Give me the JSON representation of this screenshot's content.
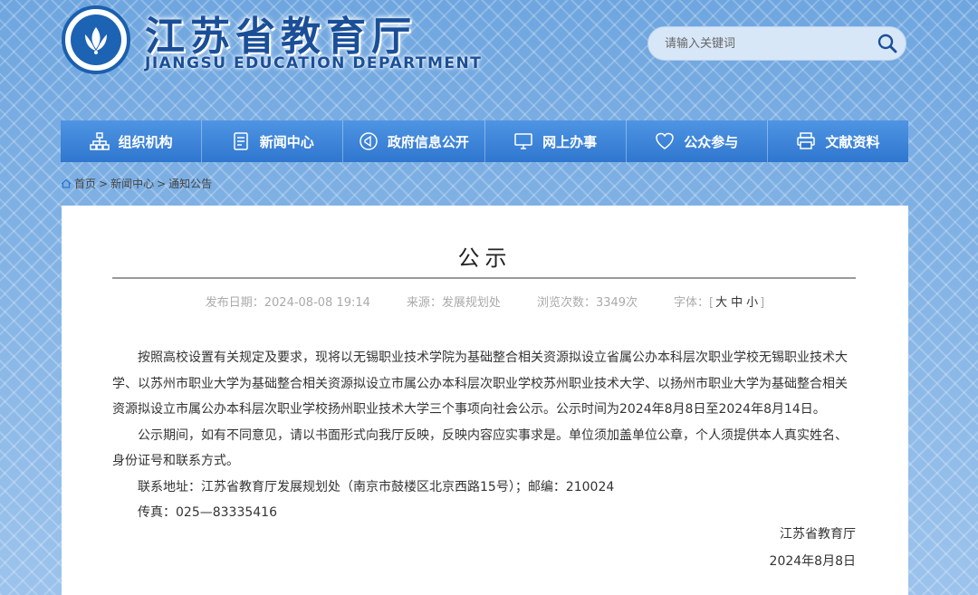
{
  "header": {
    "title": "江苏省教育厅",
    "subtitle": "JIANGSU EDUCATION DEPARTMENT",
    "search_placeholder": "请输入关键词"
  },
  "nav": {
    "items": [
      {
        "label": "组织机构",
        "icon": "org-chart-icon"
      },
      {
        "label": "新闻中心",
        "icon": "document-icon"
      },
      {
        "label": "政府信息公开",
        "icon": "megaphone-icon"
      },
      {
        "label": "网上办事",
        "icon": "monitor-icon"
      },
      {
        "label": "公众参与",
        "icon": "heart-icon"
      },
      {
        "label": "文献资料",
        "icon": "printer-icon"
      }
    ]
  },
  "breadcrumb": {
    "home": "首页",
    "news": "新闻中心",
    "current": "通知公告"
  },
  "article": {
    "title": "公示",
    "publish_date": "发布日期：2024-08-08 19:14",
    "source": "来源：发展规划处",
    "views": "浏览次数：3349次",
    "font_label": "字体：[",
    "font_large": "大",
    "font_medium": "中",
    "font_small": "小",
    "font_close": "]",
    "para1": "按照高校设置有关规定及要求，现将以无锡职业技术学院为基础整合相关资源拟设立省属公办本科层次职业学校无锡职业技术大学、以苏州市职业大学为基础整合相关资源拟设立市属公办本科层次职业学校苏州职业技术大学、以扬州市职业大学为基础整合相关资源拟设立市属公办本科层次职业学校扬州职业技术大学三个事项向社会公示。公示时间为2024年8月8日至2024年8月14日。",
    "para2": "公示期间，如有不同意见，请以书面形式向我厅反映，反映内容应实事求是。单位须加盖单位公章，个人须提供本人真实姓名、身份证号和联系方式。",
    "para3": "联系地址：江苏省教育厅发展规划处（南京市鼓楼区北京西路15号）；邮编：210024",
    "para4": "传真：025—83335416",
    "sign_org": "江苏省教育厅",
    "sign_date": "2024年8月8日"
  }
}
